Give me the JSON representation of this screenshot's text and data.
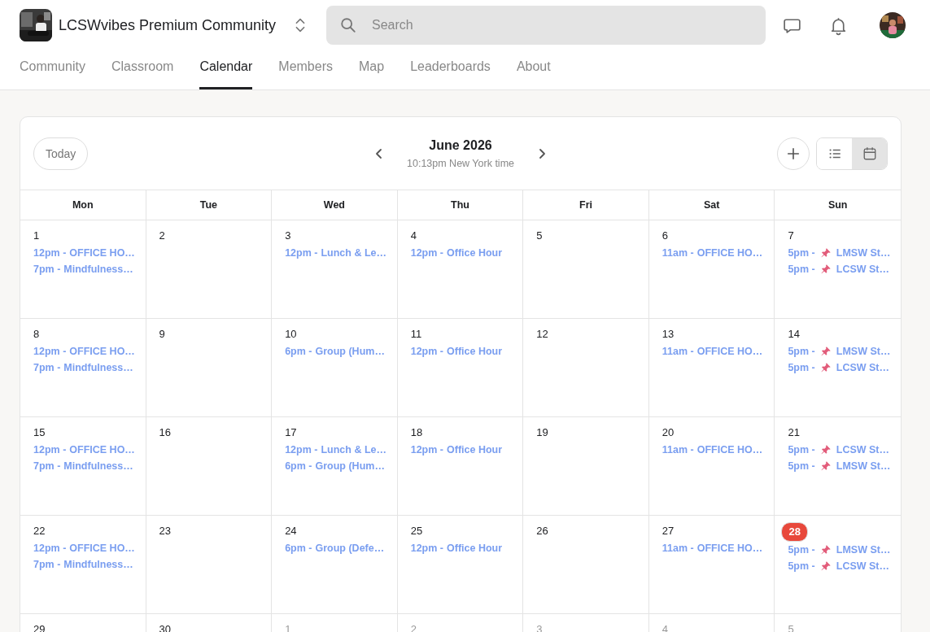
{
  "community": {
    "name": "LCSWvibes Premium Community"
  },
  "search": {
    "placeholder": "Search"
  },
  "tabs": [
    {
      "label": "Community",
      "selected": false
    },
    {
      "label": "Classroom",
      "selected": false
    },
    {
      "label": "Calendar",
      "selected": true
    },
    {
      "label": "Members",
      "selected": false
    },
    {
      "label": "Map",
      "selected": false
    },
    {
      "label": "Leaderboards",
      "selected": false
    },
    {
      "label": "About",
      "selected": false
    }
  ],
  "calendar": {
    "today_button": "Today",
    "month": "June 2026",
    "time_note": "10:13pm New York time",
    "views": [
      {
        "kind": "list",
        "selected": false
      },
      {
        "kind": "month",
        "selected": true
      }
    ],
    "weekdays": [
      "Mon",
      "Tue",
      "Wed",
      "Thu",
      "Fri",
      "Sat",
      "Sun"
    ],
    "weeks": [
      [
        {
          "day": "1",
          "muted": false,
          "today": false,
          "events": [
            {
              "time": "12pm -",
              "pinned": false,
              "title": "OFFICE HO…"
            },
            {
              "time": "7pm -",
              "pinned": false,
              "title": "Mindfulness…"
            }
          ]
        },
        {
          "day": "2",
          "muted": false,
          "today": false
        },
        {
          "day": "3",
          "muted": false,
          "today": false,
          "events": [
            {
              "time": "12pm -",
              "pinned": false,
              "title": "Lunch & Le…"
            }
          ]
        },
        {
          "day": "4",
          "muted": false,
          "today": false,
          "events": [
            {
              "time": "12pm -",
              "pinned": false,
              "title": "Office Hour"
            }
          ]
        },
        {
          "day": "5",
          "muted": false,
          "today": false
        },
        {
          "day": "6",
          "muted": false,
          "today": false,
          "events": [
            {
              "time": "11am -",
              "pinned": false,
              "title": "OFFICE HO…"
            }
          ]
        },
        {
          "day": "7",
          "muted": false,
          "today": false,
          "events": [
            {
              "time": "5pm -",
              "pinned": true,
              "title": "LMSW St…"
            },
            {
              "time": "5pm -",
              "pinned": true,
              "title": "LCSW St…"
            }
          ]
        }
      ],
      [
        {
          "day": "8",
          "muted": false,
          "today": false,
          "events": [
            {
              "time": "12pm -",
              "pinned": false,
              "title": "OFFICE HO…"
            },
            {
              "time": "7pm -",
              "pinned": false,
              "title": "Mindfulness…"
            }
          ]
        },
        {
          "day": "9",
          "muted": false,
          "today": false
        },
        {
          "day": "10",
          "muted": false,
          "today": false,
          "events": [
            {
              "time": "6pm -",
              "pinned": false,
              "title": "Group (Hum…"
            }
          ]
        },
        {
          "day": "11",
          "muted": false,
          "today": false,
          "events": [
            {
              "time": "12pm -",
              "pinned": false,
              "title": "Office Hour"
            }
          ]
        },
        {
          "day": "12",
          "muted": false,
          "today": false
        },
        {
          "day": "13",
          "muted": false,
          "today": false,
          "events": [
            {
              "time": "11am -",
              "pinned": false,
              "title": "OFFICE HO…"
            }
          ]
        },
        {
          "day": "14",
          "muted": false,
          "today": false,
          "events": [
            {
              "time": "5pm -",
              "pinned": true,
              "title": "LMSW St…"
            },
            {
              "time": "5pm -",
              "pinned": true,
              "title": "LCSW St…"
            }
          ]
        }
      ],
      [
        {
          "day": "15",
          "muted": false,
          "today": false,
          "events": [
            {
              "time": "12pm -",
              "pinned": false,
              "title": "OFFICE HO…"
            },
            {
              "time": "7pm -",
              "pinned": false,
              "title": "Mindfulness…"
            }
          ]
        },
        {
          "day": "16",
          "muted": false,
          "today": false
        },
        {
          "day": "17",
          "muted": false,
          "today": false,
          "events": [
            {
              "time": "12pm -",
              "pinned": false,
              "title": "Lunch & Le…"
            },
            {
              "time": "6pm -",
              "pinned": false,
              "title": "Group (Hum…"
            }
          ]
        },
        {
          "day": "18",
          "muted": false,
          "today": false,
          "events": [
            {
              "time": "12pm -",
              "pinned": false,
              "title": "Office Hour"
            }
          ]
        },
        {
          "day": "19",
          "muted": false,
          "today": false
        },
        {
          "day": "20",
          "muted": false,
          "today": false,
          "events": [
            {
              "time": "11am -",
              "pinned": false,
              "title": "OFFICE HO…"
            }
          ]
        },
        {
          "day": "21",
          "muted": false,
          "today": false,
          "events": [
            {
              "time": "5pm -",
              "pinned": true,
              "title": "LCSW St…"
            },
            {
              "time": "5pm -",
              "pinned": true,
              "title": "LMSW St…"
            }
          ]
        }
      ],
      [
        {
          "day": "22",
          "muted": false,
          "today": false,
          "events": [
            {
              "time": "12pm -",
              "pinned": false,
              "title": "OFFICE HO…"
            },
            {
              "time": "7pm -",
              "pinned": false,
              "title": "Mindfulness…"
            }
          ]
        },
        {
          "day": "23",
          "muted": false,
          "today": false
        },
        {
          "day": "24",
          "muted": false,
          "today": false,
          "events": [
            {
              "time": "6pm -",
              "pinned": false,
              "title": "Group (Defe…"
            }
          ]
        },
        {
          "day": "25",
          "muted": false,
          "today": false,
          "events": [
            {
              "time": "12pm -",
              "pinned": false,
              "title": "Office Hour"
            }
          ]
        },
        {
          "day": "26",
          "muted": false,
          "today": false
        },
        {
          "day": "27",
          "muted": false,
          "today": false,
          "events": [
            {
              "time": "11am -",
              "pinned": false,
              "title": "OFFICE HO…"
            }
          ]
        },
        {
          "day": "28",
          "muted": false,
          "today": true,
          "events": [
            {
              "time": "5pm -",
              "pinned": true,
              "title": "LMSW St…"
            },
            {
              "time": "5pm -",
              "pinned": true,
              "title": "LCSW St…"
            }
          ]
        }
      ],
      [
        {
          "day": "29",
          "muted": false,
          "today": false
        },
        {
          "day": "30",
          "muted": false,
          "today": false
        },
        {
          "day": "1",
          "muted": true,
          "today": false
        },
        {
          "day": "2",
          "muted": true,
          "today": false
        },
        {
          "day": "3",
          "muted": true,
          "today": false
        },
        {
          "day": "4",
          "muted": true,
          "today": false
        },
        {
          "day": "5",
          "muted": true,
          "today": false
        }
      ]
    ]
  }
}
